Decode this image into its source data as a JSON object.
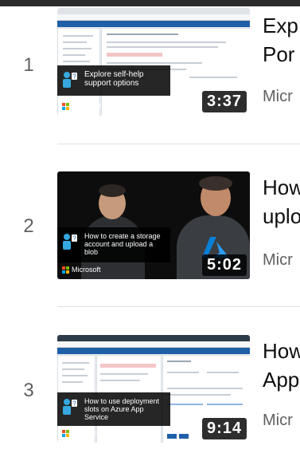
{
  "videos": [
    {
      "index": "1",
      "title_lines": [
        "Exp",
        "Por"
      ],
      "channel": "Micr",
      "duration": "3:37",
      "overlay_text": "Explore self-help support options",
      "brand": "Microsoft",
      "thumb_style": "portal"
    },
    {
      "index": "2",
      "title_lines": [
        "How",
        "uplo"
      ],
      "channel": "Micr",
      "duration": "5:02",
      "overlay_text": "How to create a storage account and upload a blob",
      "brand": "Microsoft",
      "thumb_style": "presenters"
    },
    {
      "index": "3",
      "title_lines": [
        "How",
        "App"
      ],
      "channel": "Micr",
      "duration": "9:14",
      "overlay_text": "How to use deployment slots on Azure App Service",
      "brand": "Microsoft",
      "thumb_style": "portal"
    }
  ],
  "colors": {
    "text_primary": "#0f0f0f",
    "text_secondary": "#606060",
    "azure_blue": "#1f5fa8",
    "ms_red": "#f25022",
    "ms_green": "#7fba00",
    "ms_blue": "#00a4ef",
    "ms_yellow": "#ffb900"
  },
  "icons": [
    "help-person-icon",
    "microsoft-logo",
    "azure-logo"
  ]
}
